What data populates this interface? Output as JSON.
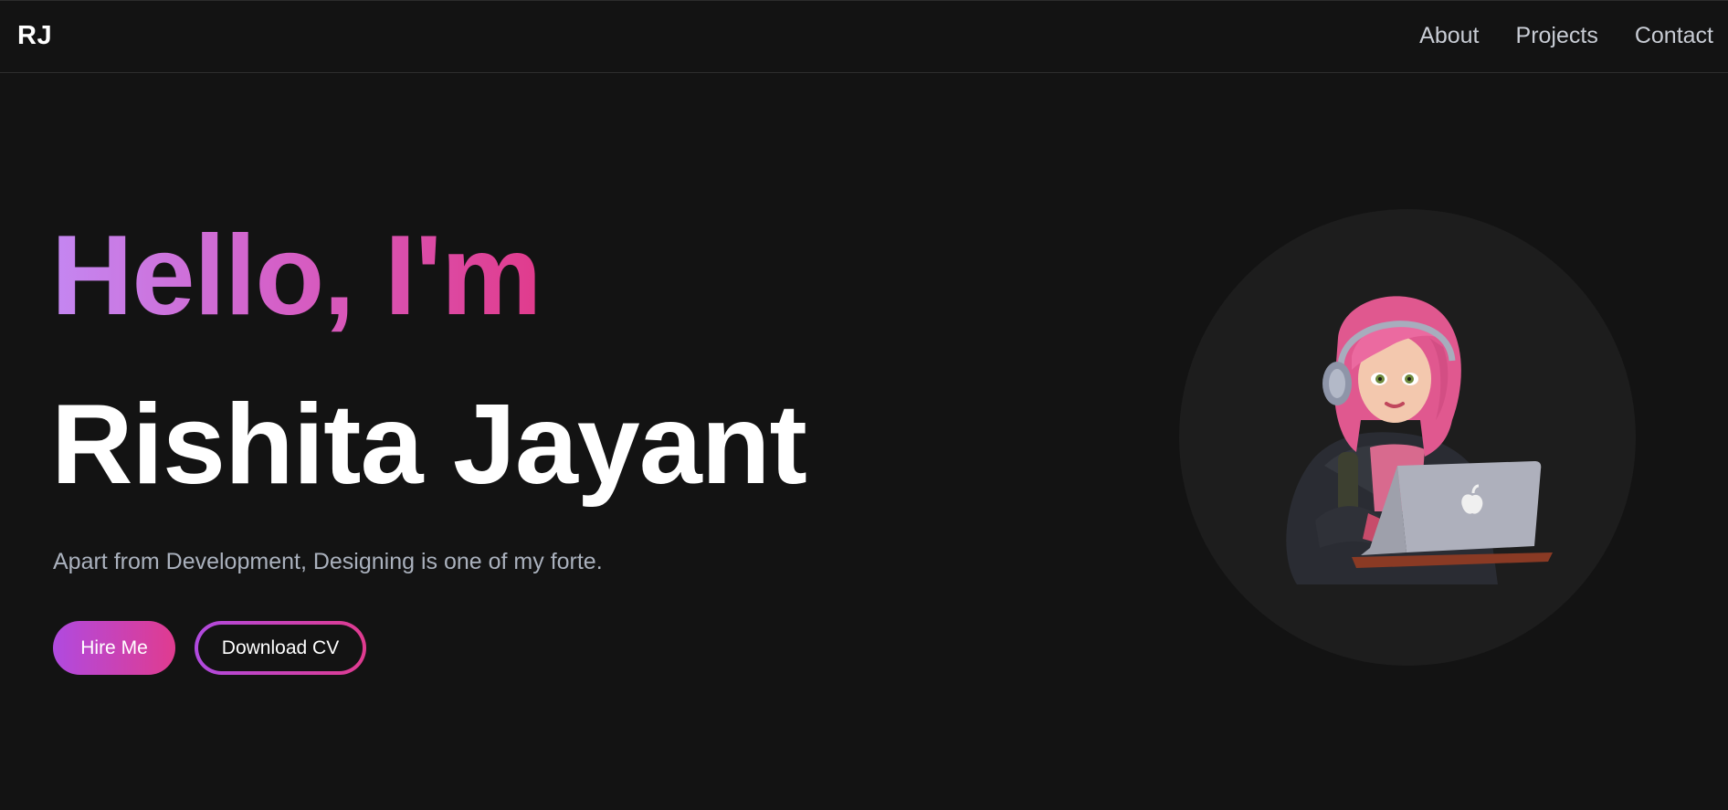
{
  "nav": {
    "logo": "RJ",
    "links": [
      "About",
      "Projects",
      "Contact"
    ]
  },
  "hero": {
    "greeting": "Hello, I'm",
    "name": "Rishita Jayant",
    "tagline": "Apart from Development, Designing is one of my forte.",
    "buttons": {
      "hire": "Hire Me",
      "download": "Download CV"
    },
    "illustration": "avatar-girl-with-laptop"
  },
  "colors": {
    "background": "#131313",
    "gradient_start": "#c487f2",
    "gradient_mid": "#d461c9",
    "gradient_end": "#e13b8c",
    "button_start": "#b04ae0",
    "button_end": "#e03b8f",
    "nav_text": "#c8ccd4",
    "tagline_text": "#aab1bd",
    "circle_bg": "#1d1d1d"
  }
}
